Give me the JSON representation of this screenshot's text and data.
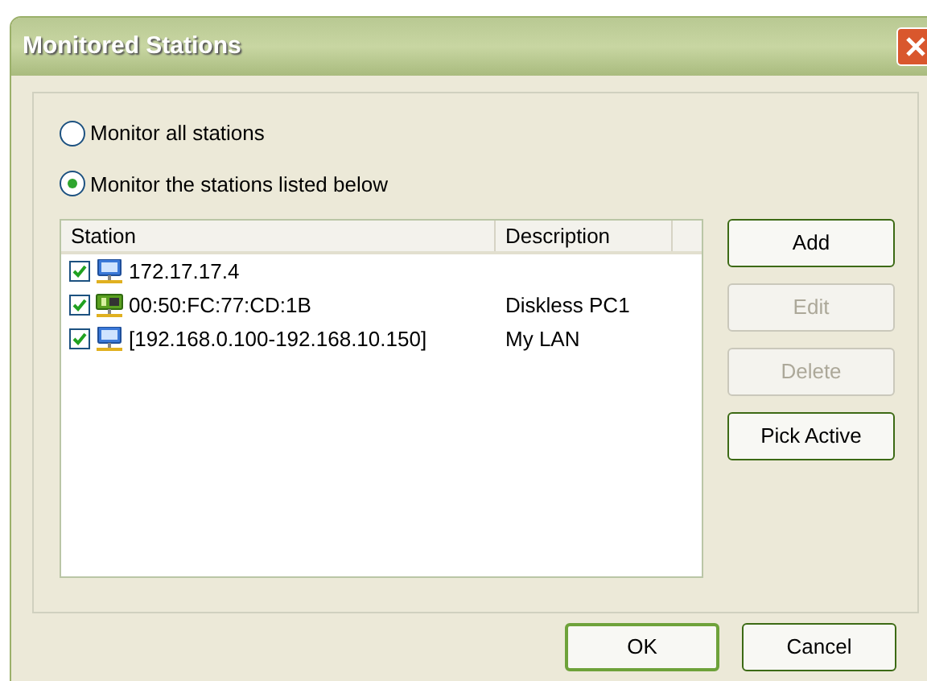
{
  "window": {
    "title": "Monitored Stations"
  },
  "radios": [
    {
      "label": "Monitor all stations",
      "selected": false
    },
    {
      "label": "Monitor the stations listed below",
      "selected": true
    }
  ],
  "table": {
    "columns": [
      "Station",
      "Description"
    ],
    "rows": [
      {
        "kind": "ip",
        "checked": true,
        "station": "172.17.17.4",
        "description": ""
      },
      {
        "kind": "mac",
        "checked": true,
        "station": "00:50:FC:77:CD:1B",
        "description": "Diskless PC1"
      },
      {
        "kind": "ip",
        "checked": true,
        "station": "[192.168.0.100-192.168.10.150]",
        "description": "My LAN"
      }
    ]
  },
  "side_buttons": [
    {
      "label": "Add",
      "disabled": false
    },
    {
      "label": "Edit",
      "disabled": true
    },
    {
      "label": "Delete",
      "disabled": true
    },
    {
      "label": "Pick Active",
      "disabled": false
    }
  ],
  "footer_buttons": [
    {
      "label": "OK",
      "default": true
    },
    {
      "label": "Cancel",
      "default": false
    }
  ]
}
